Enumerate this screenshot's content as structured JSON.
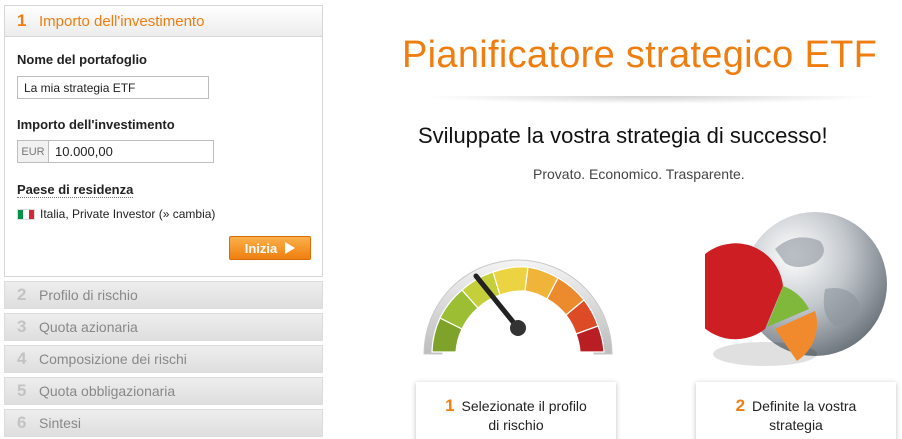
{
  "sidebar": {
    "active_step": {
      "number": "1",
      "label": "Importo dell'investimento"
    },
    "form": {
      "portfolio_name_label": "Nome del portafoglio",
      "portfolio_name_value": "La mia strategia ETF",
      "amount_label": "Importo dell'investimento",
      "currency": "EUR",
      "amount_value": "10.000,00",
      "country_label": "Paese di residenza",
      "country_value": "Italia, Private Investor (» cambia)",
      "start_button": "Inizia"
    },
    "steps": [
      {
        "number": "2",
        "label": "Profilo di rischio"
      },
      {
        "number": "3",
        "label": "Quota azionaria"
      },
      {
        "number": "4",
        "label": "Composizione dei rischi"
      },
      {
        "number": "5",
        "label": "Quota obbligazionaria"
      },
      {
        "number": "6",
        "label": "Sintesi"
      }
    ]
  },
  "main": {
    "title": "Pianificatore strategico ETF",
    "subtitle": "Sviluppate la vostra strategia di successo!",
    "tagline": "Provato. Economico. Trasparente.",
    "cards": [
      {
        "number": "1",
        "line1": "Selezionate il profilo",
        "line2": "di rischio"
      },
      {
        "number": "2",
        "line1": "Definite la vostra",
        "line2": "strategia"
      }
    ]
  },
  "colors": {
    "accent": "#ef7d0f",
    "button": "#f5961f"
  },
  "icons": {
    "play": "play-triangle-icon",
    "flag": "italy-flag-icon",
    "gauge": "risk-gauge-icon",
    "globe": "globe-pie-icon"
  }
}
